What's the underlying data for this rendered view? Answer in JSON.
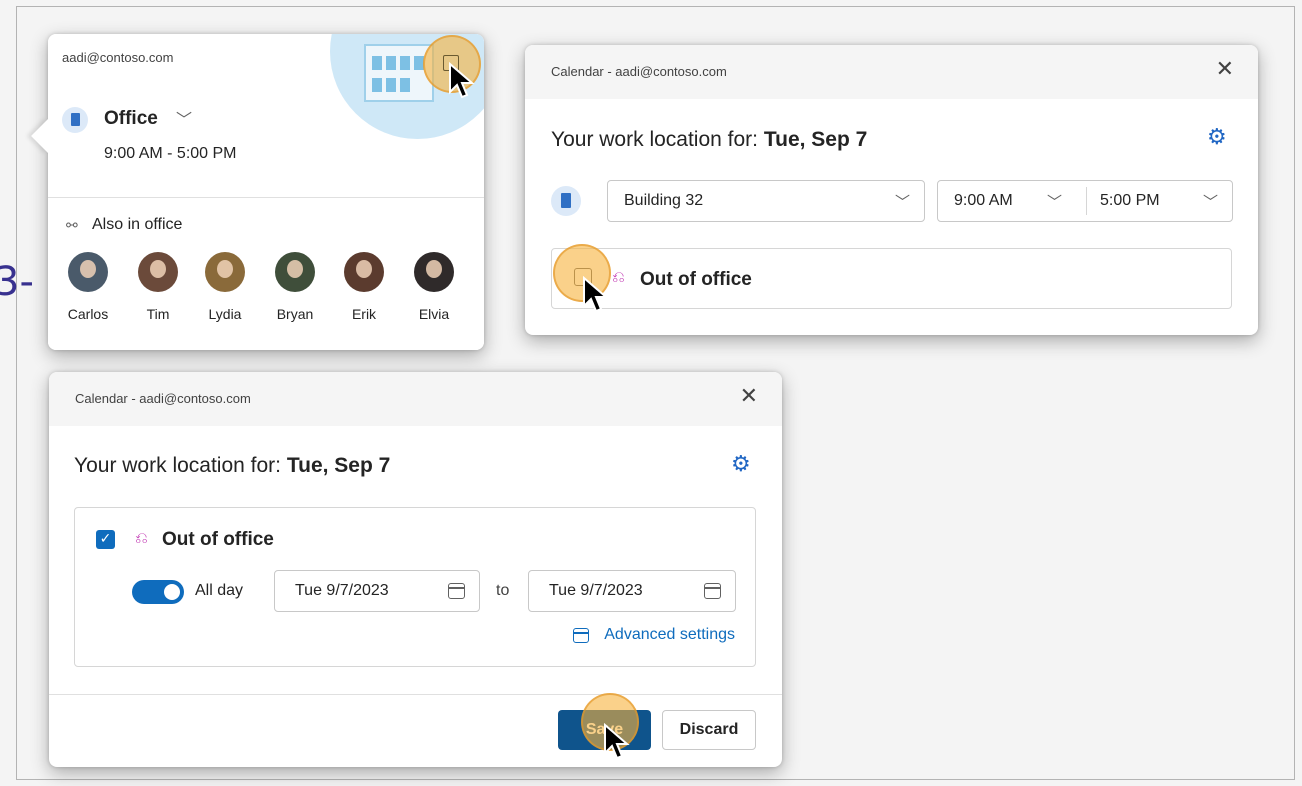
{
  "flyout": {
    "email": "aadi@contoso.com",
    "location": "Office",
    "hours": "9:00 AM - 5:00 PM",
    "also_in_office_label": "Also in office",
    "people": [
      {
        "name": "Carlos",
        "color": "#4a5a6a"
      },
      {
        "name": "Tim",
        "color": "#6b4a3a"
      },
      {
        "name": "Lydia",
        "color": "#8a6a3a"
      },
      {
        "name": "Bryan",
        "color": "#3f4e3a"
      },
      {
        "name": "Erik",
        "color": "#5b3b2e"
      },
      {
        "name": "Elvia",
        "color": "#2f2a2a"
      }
    ]
  },
  "dialog_location": {
    "header_title": "Calendar - aadi@contoso.com",
    "close_glyph": "✕",
    "work_location_prefix": "Your work location for:",
    "date": "Tue, Sep 7",
    "building": "Building 32",
    "start_time": "9:00 AM",
    "end_time": "5:00 PM",
    "out_of_office_label": "Out of office"
  },
  "dialog_ooo": {
    "header_title": "Calendar - aadi@contoso.com",
    "close_glyph": "✕",
    "work_location_prefix": "Your work location for:",
    "date": "Tue, Sep 7",
    "out_of_office_label": "Out of office",
    "out_of_office_checked": true,
    "all_day_label": "All day",
    "all_day_on": true,
    "start_date": "Tue 9/7/2023",
    "to_label": "to",
    "end_date": "Tue 9/7/2023",
    "advanced_settings_label": "Advanced settings",
    "save_label": "Save",
    "discard_label": "Discard"
  },
  "colors": {
    "accent": "#0f6cbd",
    "primary_button": "#0f548c",
    "ooo_icon": "#c239b3",
    "click_highlight": "#f6b23c"
  }
}
